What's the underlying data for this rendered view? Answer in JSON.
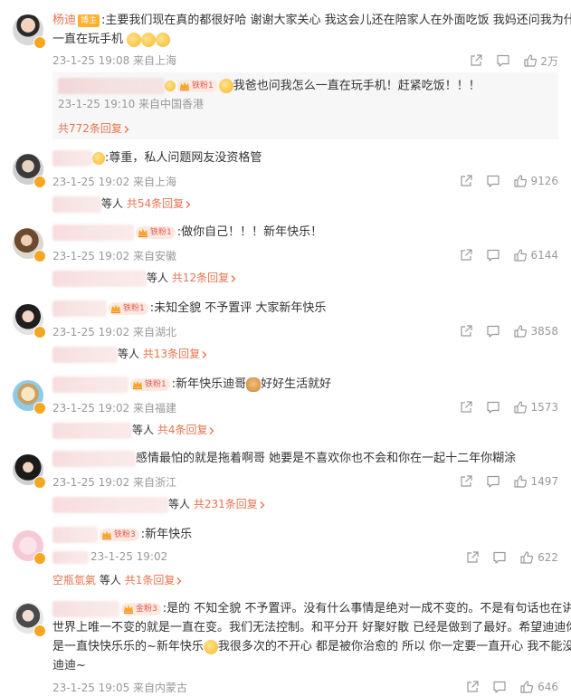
{
  "icons": {
    "share": "share-icon",
    "comment": "comment-icon",
    "like": "thumb-up-icon",
    "chevron": "chevron-right-icon",
    "verified": "verified-badge-icon"
  },
  "colors": {
    "accent": "#eb7350",
    "meta": "#999999",
    "fan_badge_bg": "#fde9e2"
  },
  "comments": [
    {
      "user": "杨迪",
      "badge": "博主",
      "text_line1": ":主要我们现在真的都很好哈 谢谢大家关心 我这会儿还在陪家人在外面吃饭 我妈还问我为什么",
      "text_line2": "一直在玩手机",
      "meta": "23-1-25 19:08 来自上海",
      "like_count": "2万",
      "reply": {
        "fan_badge": "铁粉1",
        "text": "我爸也问我怎么一直在玩手机！赶紧吃饭！！！",
        "meta": "23-1-25 19:10 来自中国香港",
        "count": "共772条回复"
      }
    },
    {
      "text": ":尊重，私人问题网友没资格管",
      "meta": "23-1-25 19:02 来自上海",
      "like_count": "9126",
      "others": "等人",
      "count": "共54条回复"
    },
    {
      "fan_badge": "铁粉1",
      "text": ":做你自己！！！新年快乐！",
      "meta": "23-1-25 19:02 来自安徽",
      "like_count": "6144",
      "others": "等人",
      "count": "共12条回复"
    },
    {
      "fan_badge": "铁粉1",
      "text": ":未知全貌 不予置评 大家新年快乐",
      "meta": "23-1-25 19:02 来自湖北",
      "like_count": "3858",
      "others": "等人",
      "count": "共13条回复"
    },
    {
      "fan_badge": "铁粉1",
      "text_a": ":新年快乐迪哥",
      "text_b": "好好生活就好",
      "meta": "23-1-25 19:02 来自福建",
      "like_count": "1573",
      "others": "等人",
      "count": "共4条回复"
    },
    {
      "text": "感情最怕的就是拖着啊哥 她要是不喜欢你也不会和你在一起十二年你糊涂",
      "meta": "23-1-25 19:02 来自浙江",
      "like_count": "1497",
      "others": "等人",
      "count": "共231条回复"
    },
    {
      "fan_badge": "铁粉3",
      "text": ":新年快乐",
      "meta": "23-1-25 19:02",
      "like_count": "622",
      "replier": "空瓶氫氣",
      "others": "等人",
      "count": "共1条回复"
    },
    {
      "fan_badge": "金粉3",
      "text_line1": ":是的 不知全貌 不予置评。没有什么事情是绝对一成不变的。不是有句话也在讲吗",
      "text_line2": "世界上唯一不变的就是一直在变。我们无法控制。和平分开 好聚好散 已经是做到了最好。希望迪迪你还",
      "text_line3a": "是一直快快乐乐的~新年快乐",
      "text_line3b": "我很多次的不开心 都是被你治愈的 所以 你一定要一直开心 我不能没有",
      "text_line4": "迪迪~",
      "meta": "23-1-25 19:05 来自内蒙古",
      "like_count": "646"
    }
  ]
}
